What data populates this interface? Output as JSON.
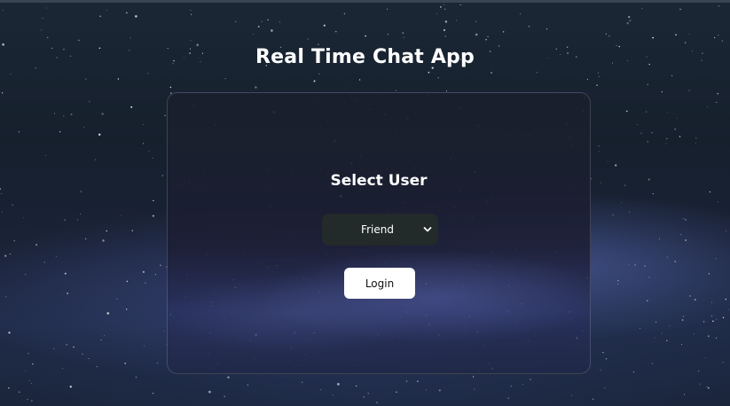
{
  "header": {
    "title": "Real Time Chat App"
  },
  "login_card": {
    "heading": "Select User",
    "user_select": {
      "selected": "Friend",
      "icon": "chevron-down-icon"
    },
    "login_label": "Login"
  },
  "colors": {
    "background_dark": "#16202d",
    "select_bg": "#222a2a",
    "button_bg": "#ffffff",
    "text": "#ffffff"
  }
}
